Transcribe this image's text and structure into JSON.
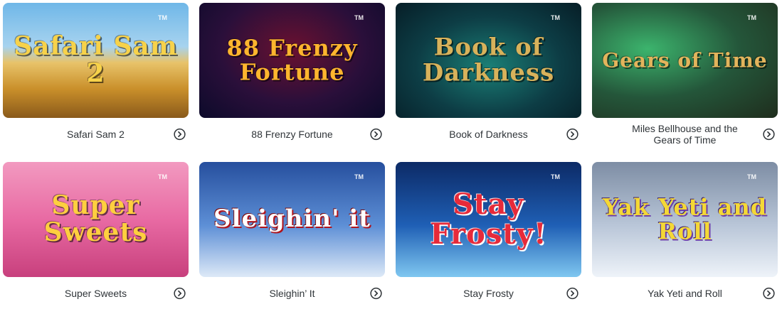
{
  "games": [
    {
      "name": "Safari Sam 2",
      "thumb_text": "Safari Sam 2",
      "theme": "safari"
    },
    {
      "name": "88 Frenzy Fortune",
      "thumb_text": "88 Frenzy Fortune",
      "theme": "frenzy"
    },
    {
      "name": "Book of Darkness",
      "thumb_text": "Book of Darkness",
      "theme": "darkness"
    },
    {
      "name": "Miles Bellhouse and the Gears of Time",
      "thumb_text": "Gears of Time",
      "theme": "gears"
    },
    {
      "name": "Super Sweets",
      "thumb_text": "Super Sweets",
      "theme": "sweets"
    },
    {
      "name": "Sleighin’ It",
      "thumb_text": "Sleighin' it",
      "theme": "sleighin"
    },
    {
      "name": "Stay Frosty",
      "thumb_text": "Stay Frosty!",
      "theme": "frosty"
    },
    {
      "name": "Yak Yeti and Roll",
      "thumb_text": "Yak Yeti and Roll",
      "theme": "yak"
    }
  ],
  "trademark": "TM",
  "icons": {
    "card_action": "chevron-circle-right-icon"
  },
  "colors": {
    "caption_text": "#2f3438",
    "icon_stroke": "#2f3438",
    "page_bg": "#ffffff"
  }
}
